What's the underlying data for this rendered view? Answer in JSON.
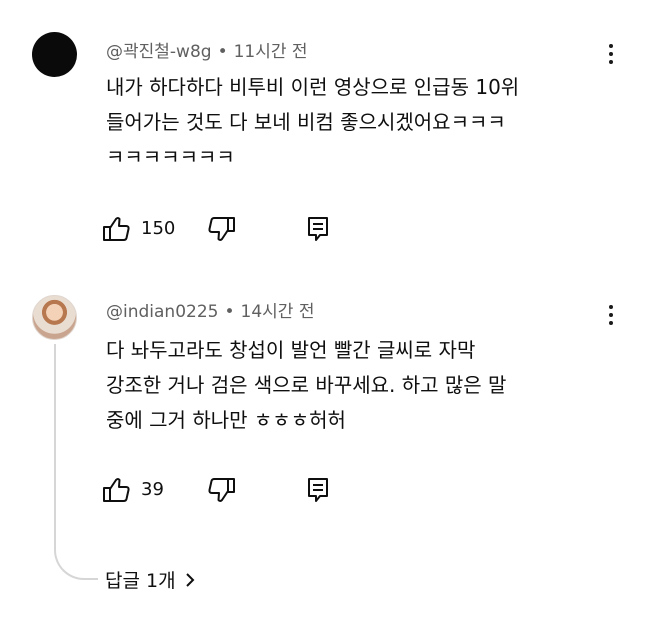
{
  "comments": [
    {
      "author": "@곽진철-w8g",
      "dot": "•",
      "time": "11시간 전",
      "lines": [
        "내가 하다하다 비투비 이런 영상으로 인급동 10위",
        "들어가는 것도 다 보네 비컴 좋으시겠어요ㅋㅋㅋ",
        "ㅋㅋㅋㅋㅋㅋㅋ"
      ],
      "likes": "150",
      "icons": {
        "like": "thumbs-up-icon",
        "dislike": "thumbs-down-icon",
        "reply": "reply-icon",
        "more": "more-vert-icon"
      }
    },
    {
      "author": "@indian0225",
      "dot": "•",
      "time": "14시간 전",
      "lines": [
        "다 놔두고라도 창섭이 발언 빨간 글씨로 자막",
        "강조한 거나 검은 색으로 바꾸세요. 하고 많은 말",
        "중에 그거 하나만 ㅎㅎㅎ허허"
      ],
      "likes": "39",
      "icons": {
        "like": "thumbs-up-icon",
        "dislike": "thumbs-down-icon",
        "reply": "reply-icon",
        "more": "more-vert-icon"
      }
    }
  ],
  "replies": {
    "label": "답글 1개",
    "icon": "chevron-right-icon"
  },
  "colors": {
    "text": "#0f0f0f",
    "meta": "#606060",
    "thread": "#d6d6d6"
  }
}
